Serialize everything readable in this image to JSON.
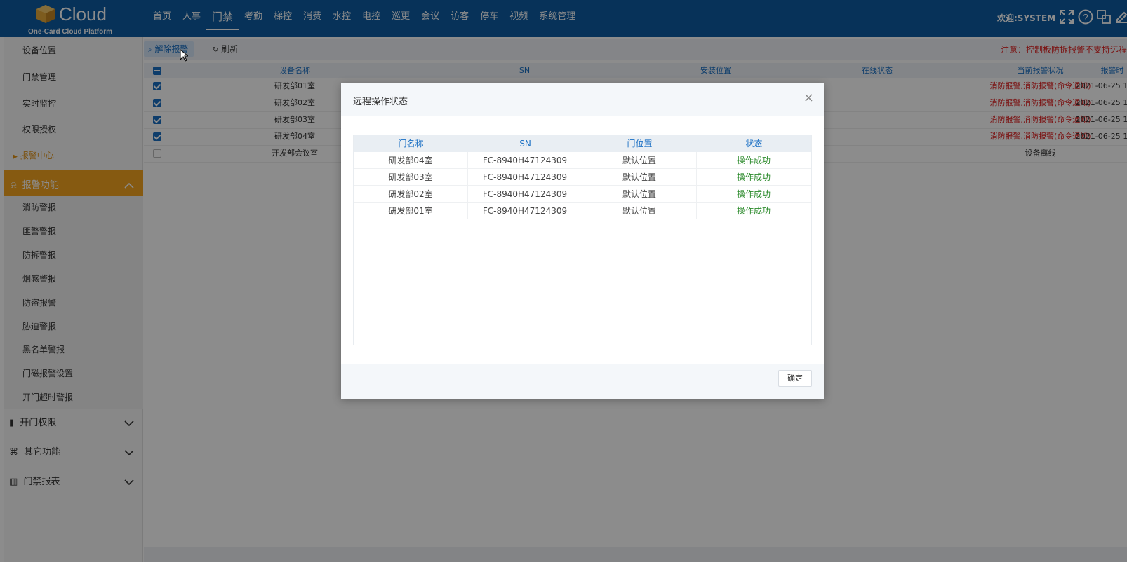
{
  "header": {
    "logo_text": "Cloud",
    "logo_sub": "One-Card Cloud Platform",
    "nav": [
      "首页",
      "人事",
      "门禁",
      "考勤",
      "梯控",
      "消费",
      "水控",
      "电控",
      "巡更",
      "会议",
      "访客",
      "停车",
      "视频",
      "系统管理"
    ],
    "active_nav": "门禁",
    "welcome": "欢迎:SYSTEM"
  },
  "sidebar": {
    "top_items": [
      "设备位置",
      "门禁管理",
      "实时监控",
      "权限授权"
    ],
    "current": "报警中心",
    "active_group": "报警功能",
    "sub_items": [
      "消防警报",
      "匪警警报",
      "防拆警报",
      "烟感警报",
      "防盗报警",
      "胁迫警报",
      "黑名单警报",
      "门磁报警设置",
      "开门超时警报"
    ],
    "groups": [
      "开门权限",
      "其它功能",
      "门禁报表"
    ]
  },
  "toolbar": {
    "release_label": "解除报警",
    "refresh_label": "刷新",
    "notice": "注意：控制板防拆报警不支持远程"
  },
  "grid": {
    "columns": [
      "设备名称",
      "SN",
      "安装位置",
      "在线状态",
      "当前报警状况",
      "报警时"
    ],
    "rows": [
      {
        "name": "研发部01室",
        "alarm": "消防报警,消防报警(命令通知)",
        "time": "2021-06-25 1",
        "checked": true
      },
      {
        "name": "研发部02室",
        "alarm": "消防报警,消防报警(命令通知)",
        "time": "2021-06-25 1",
        "checked": true
      },
      {
        "name": "研发部03室",
        "alarm": "消防报警,消防报警(命令通知)",
        "time": "2021-06-25 1",
        "checked": true
      },
      {
        "name": "研发部04室",
        "alarm": "消防报警,消防报警(命令通知)",
        "time": "2021-06-25 1",
        "checked": true
      },
      {
        "name": "开发部会议室",
        "alarm": "设备离线",
        "time": "",
        "checked": false
      }
    ]
  },
  "dialog": {
    "title": "远程操作状态",
    "columns": [
      "门名称",
      "SN",
      "门位置",
      "状态"
    ],
    "rows": [
      {
        "door": "研发部04室",
        "sn": "FC-8940H47124309",
        "location": "默认位置",
        "status": "操作成功"
      },
      {
        "door": "研发部03室",
        "sn": "FC-8940H47124309",
        "location": "默认位置",
        "status": "操作成功"
      },
      {
        "door": "研发部02室",
        "sn": "FC-8940H47124309",
        "location": "默认位置",
        "status": "操作成功"
      },
      {
        "door": "研发部01室",
        "sn": "FC-8940H47124309",
        "location": "默认位置",
        "status": "操作成功"
      }
    ],
    "ok_label": "确定",
    "close_symbol": "×"
  },
  "colors": {
    "header_bg": "#0d5ca3",
    "accent_orange": "#f4a41f",
    "alarm_red": "#e02020",
    "success_green": "#2b8a2b"
  }
}
